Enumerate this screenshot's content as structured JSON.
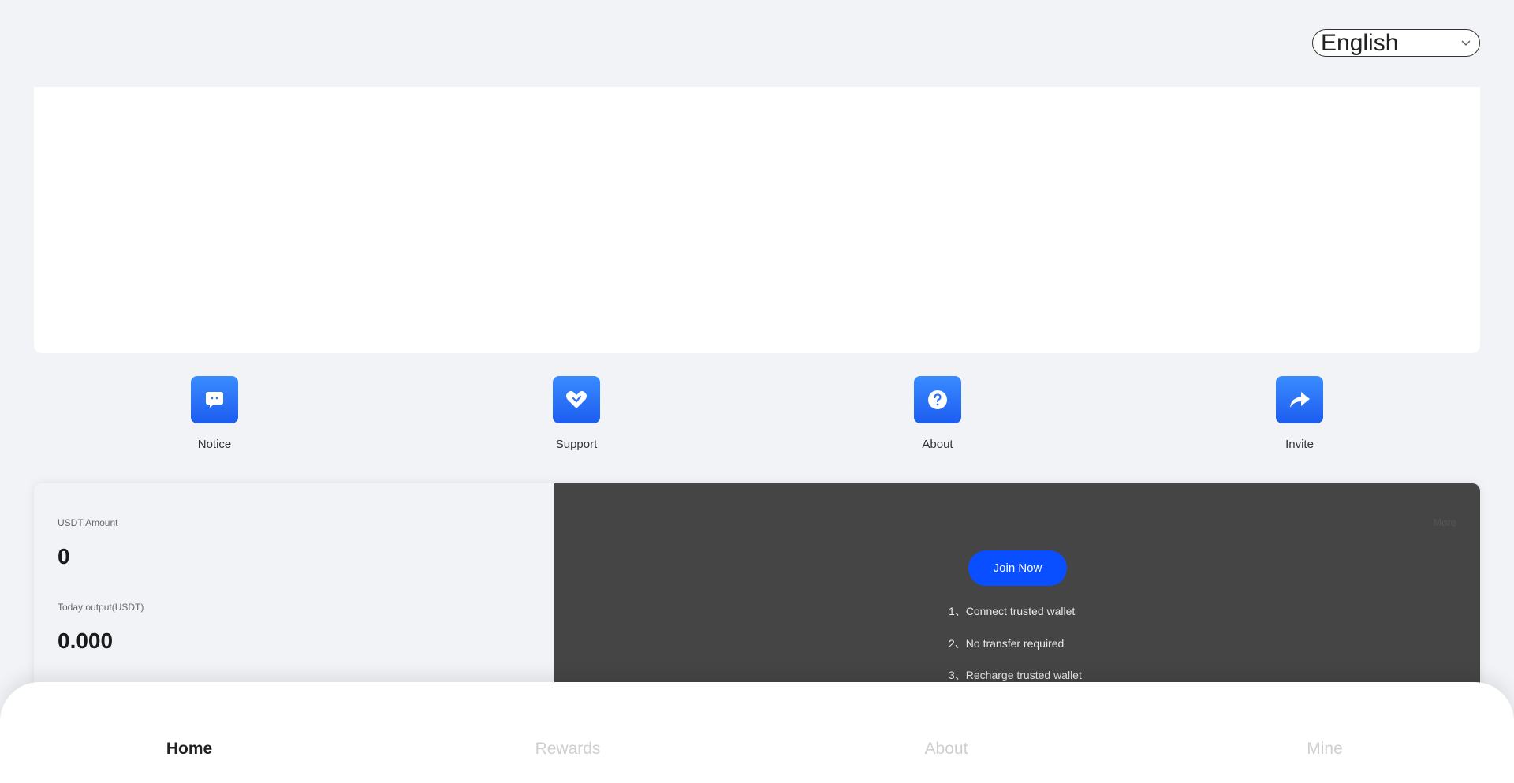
{
  "language_select": {
    "value": "English",
    "options": [
      "English"
    ]
  },
  "actions": [
    {
      "label": "Notice",
      "icon": "chat-bubble-icon"
    },
    {
      "label": "Support",
      "icon": "heart-handshake-icon"
    },
    {
      "label": "About",
      "icon": "question-circle-icon"
    },
    {
      "label": "Invite",
      "icon": "share-arrow-icon"
    }
  ],
  "stats": {
    "usdt_amount_label": "USDT Amount",
    "usdt_amount_value": "0",
    "today_output_label": "Today output(USDT)",
    "today_output_value": "0.000",
    "more_label": "More",
    "join_label": "Join Now",
    "steps": [
      "1、Connect trusted wallet",
      "2、No transfer required",
      "3、Recharge trusted wallet"
    ]
  },
  "bottom_nav": {
    "items": [
      {
        "label": "Home",
        "active": true
      },
      {
        "label": "Rewards",
        "active": false
      },
      {
        "label": "About",
        "active": false
      },
      {
        "label": "Mine",
        "active": false
      }
    ]
  },
  "colors": {
    "background": "#f1f3f7",
    "accent_blue": "#0a4fff",
    "tile_blue": "#2a72f8",
    "dark_panel": "#454545"
  }
}
